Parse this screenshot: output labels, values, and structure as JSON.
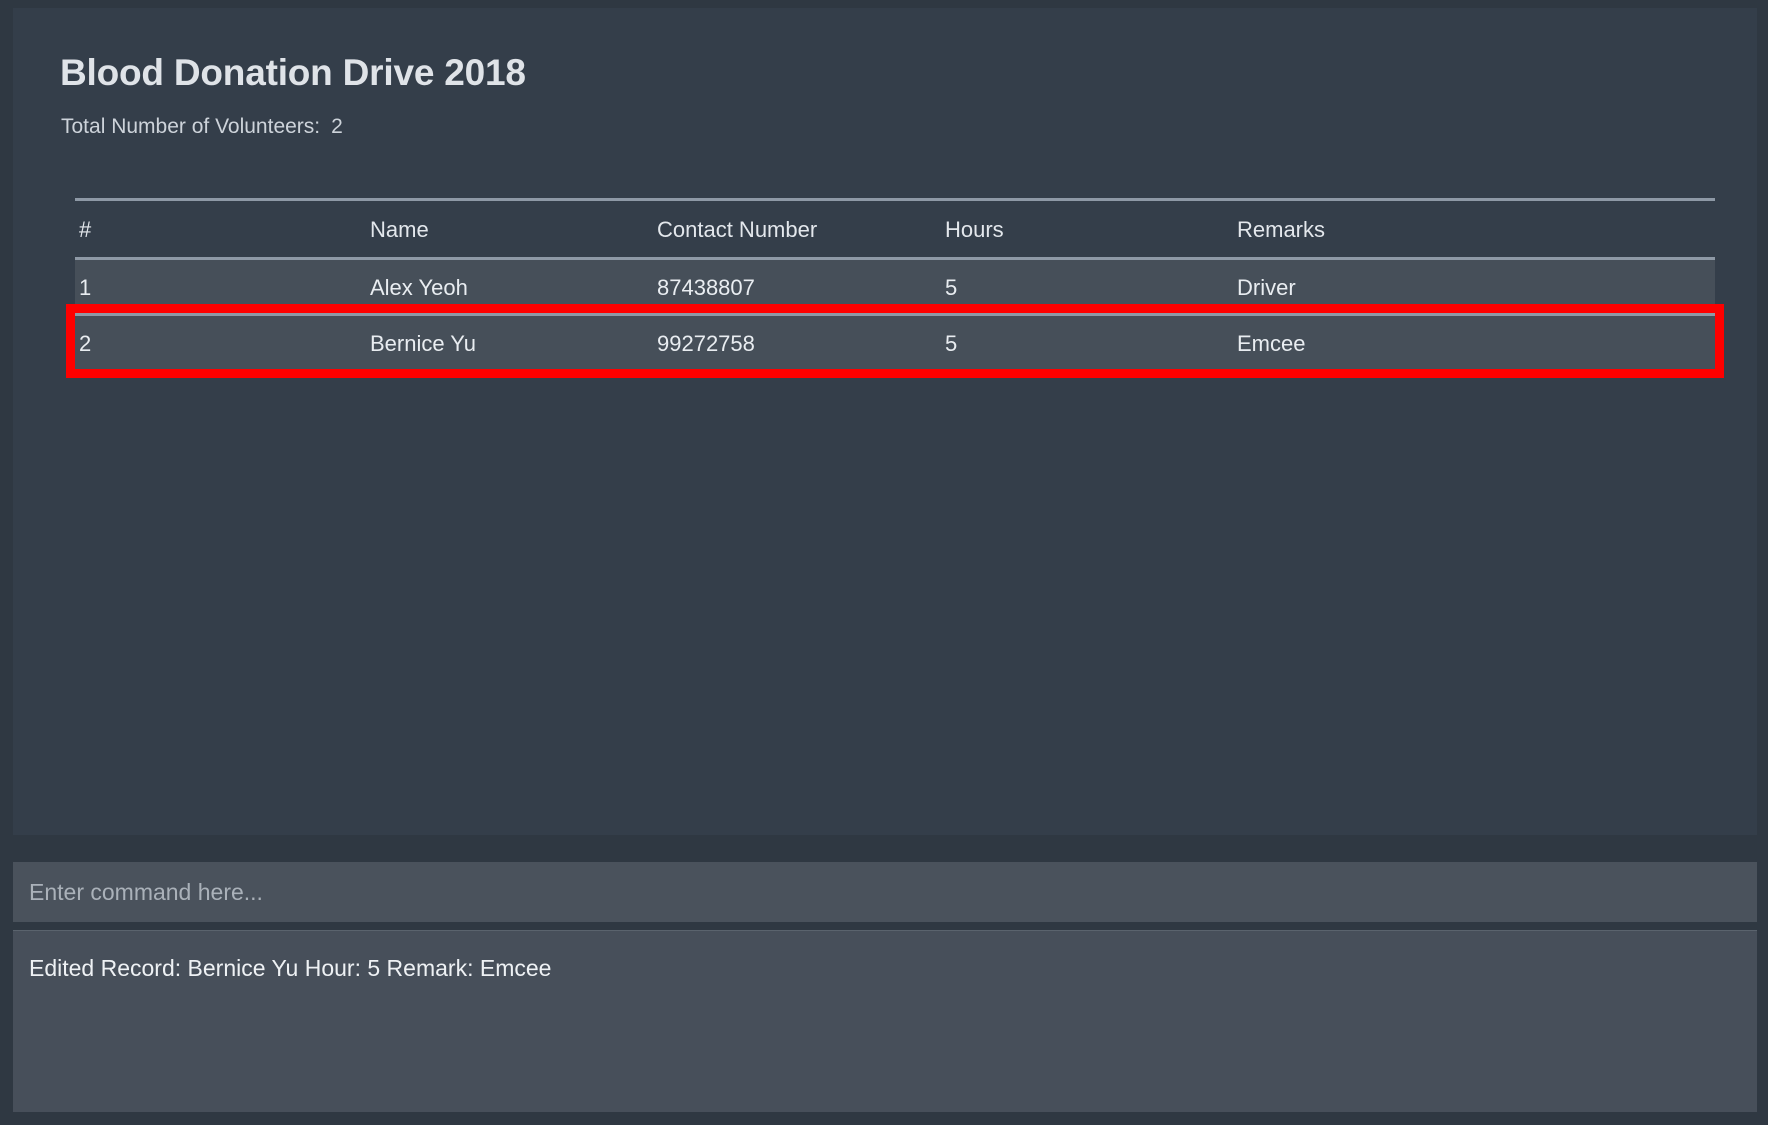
{
  "window": {
    "background_color": "#2f3842",
    "panel_color": "#343e4a"
  },
  "header": {
    "title": "Blood Donation Drive 2018",
    "total_label": "Total Number of Volunteers:",
    "total_value": "2"
  },
  "table": {
    "columns": [
      "#",
      "Name",
      "Contact Number",
      "Hours",
      "Remarks"
    ],
    "rows": [
      {
        "index": "1",
        "name": "Alex Yeoh",
        "contact": "87438807",
        "hours": "5",
        "remarks": "Driver",
        "highlighted": false
      },
      {
        "index": "2",
        "name": "Bernice Yu",
        "contact": "99272758",
        "hours": "5",
        "remarks": "Emcee",
        "highlighted": true
      }
    ],
    "highlight_color": "#fe0000"
  },
  "command": {
    "value": "",
    "placeholder": "Enter command here..."
  },
  "result": {
    "message": "Edited Record: Bernice Yu Hour: 5 Remark: Emcee"
  }
}
